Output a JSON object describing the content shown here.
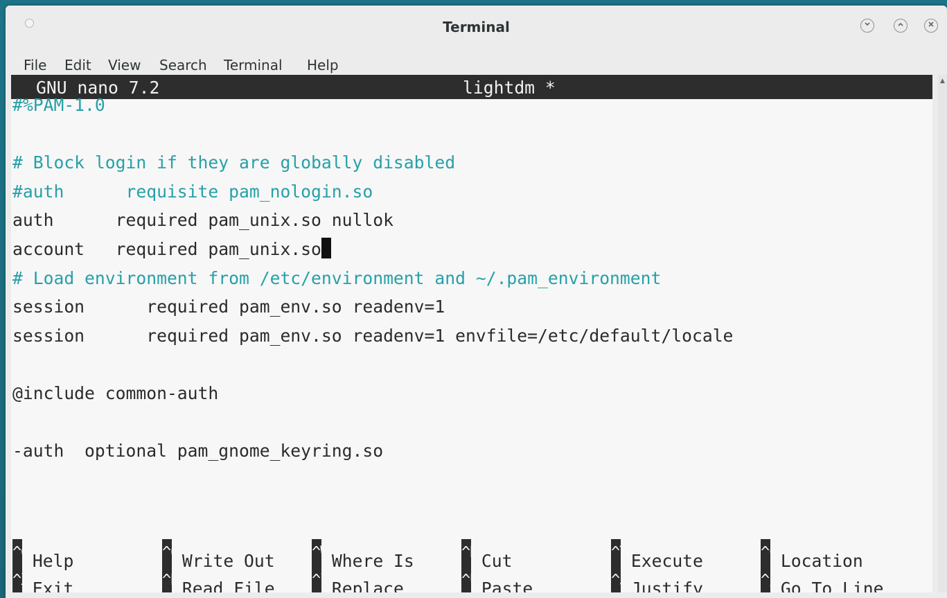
{
  "window": {
    "title": "Terminal"
  },
  "menu": {
    "items": [
      "File",
      "Edit",
      "View",
      "Search",
      "Terminal",
      "Help"
    ]
  },
  "nano": {
    "version": "GNU nano 7.2",
    "filename": "lightdm *"
  },
  "file_lines": [
    {
      "text": "#%PAM-1.0",
      "style": "comment"
    },
    {
      "text": "",
      "style": "plain"
    },
    {
      "text": "# Block login if they are globally disabled",
      "style": "comment"
    },
    {
      "text": "#auth      requisite pam_nologin.so",
      "style": "comment"
    },
    {
      "text": "auth      required pam_unix.so nullok",
      "style": "plain"
    },
    {
      "text": "account   required pam_unix.so",
      "style": "plain"
    },
    {
      "text": "# Load environment from /etc/environment and ~/.pam_environment",
      "style": "comment"
    },
    {
      "text": "session      required pam_env.so readenv=1",
      "style": "plain"
    },
    {
      "text": "session      required pam_env.so readenv=1 envfile=/etc/default/locale",
      "style": "plain"
    },
    {
      "text": "",
      "style": "plain"
    },
    {
      "text": "@include common-auth",
      "style": "plain"
    },
    {
      "text": "",
      "style": "plain"
    },
    {
      "text": "-auth  optional pam_gnome_keyring.so",
      "style": "plain"
    }
  ],
  "shortcuts": [
    {
      "key": "^G",
      "label": "Help"
    },
    {
      "key": "^O",
      "label": "Write Out"
    },
    {
      "key": "^W",
      "label": "Where Is"
    },
    {
      "key": "^K",
      "label": "Cut"
    },
    {
      "key": "^T",
      "label": "Execute"
    },
    {
      "key": "^C",
      "label": "Location"
    },
    {
      "key": "^X",
      "label": "Exit"
    },
    {
      "key": "^R",
      "label": "Read File"
    },
    {
      "key": "^\\",
      "label": "Replace"
    },
    {
      "key": "^U",
      "label": "Paste"
    },
    {
      "key": "^J",
      "label": "Justify"
    },
    {
      "key": "^/",
      "label": "Go To Line"
    }
  ],
  "colors": {
    "comment": "#27a0a8",
    "header_bg": "#2d2d2d",
    "terminal_bg": "#f7f7f7"
  }
}
